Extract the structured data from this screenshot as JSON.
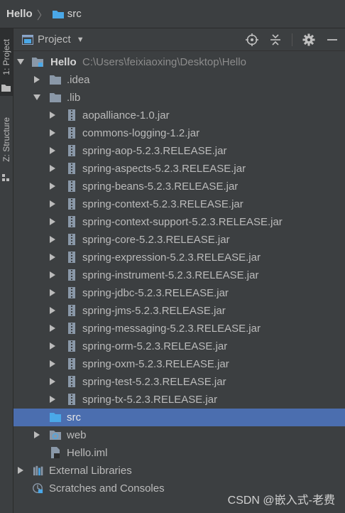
{
  "breadcrumb": {
    "root": "Hello",
    "leaf": "src"
  },
  "toolstrip": {
    "project_tab": "1: Project",
    "structure_tab": "Z: Structure"
  },
  "panel": {
    "view_label": "Project"
  },
  "tree": {
    "root": {
      "name": "Hello",
      "path": "C:\\Users\\feixiaoxing\\Desktop\\Hello"
    },
    "idea": ".idea",
    "lib": ".lib",
    "jars": [
      "aopalliance-1.0.jar",
      "commons-logging-1.2.jar",
      "spring-aop-5.2.3.RELEASE.jar",
      "spring-aspects-5.2.3.RELEASE.jar",
      "spring-beans-5.2.3.RELEASE.jar",
      "spring-context-5.2.3.RELEASE.jar",
      "spring-context-support-5.2.3.RELEASE.jar",
      "spring-core-5.2.3.RELEASE.jar",
      "spring-expression-5.2.3.RELEASE.jar",
      "spring-instrument-5.2.3.RELEASE.jar",
      "spring-jdbc-5.2.3.RELEASE.jar",
      "spring-jms-5.2.3.RELEASE.jar",
      "spring-messaging-5.2.3.RELEASE.jar",
      "spring-orm-5.2.3.RELEASE.jar",
      "spring-oxm-5.2.3.RELEASE.jar",
      "spring-test-5.2.3.RELEASE.jar",
      "spring-tx-5.2.3.RELEASE.jar"
    ],
    "src": "src",
    "web": "web",
    "iml": "Hello.iml",
    "external_libraries": "External Libraries",
    "scratches": "Scratches and Consoles"
  },
  "watermark": "CSDN @嵌入式-老费",
  "colors": {
    "background": "#3c3f41",
    "selection": "#4b6eaf",
    "folder": "#8a98a8",
    "src_folder": "#4aa8e8",
    "text": "#bbbbbb"
  }
}
